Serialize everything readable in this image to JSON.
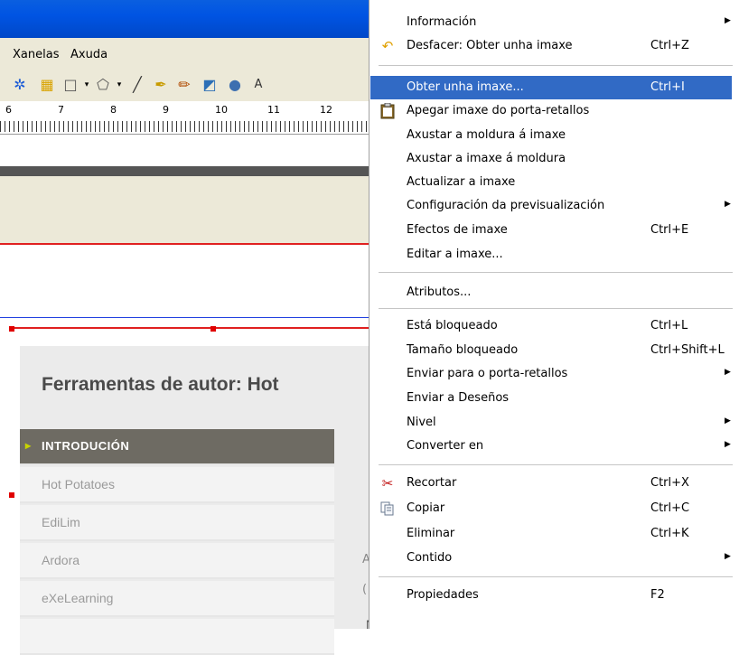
{
  "menubar": {
    "items": [
      "Xanelas",
      "Axuda"
    ]
  },
  "toolbar": {
    "icons": [
      "settings-icon",
      "table-icon",
      "rectangle-icon",
      "polygon-icon",
      "line-icon",
      "pen-icon",
      "pencil-icon",
      "image-icon",
      "zoom-icon",
      "text-icon"
    ]
  },
  "ruler": {
    "numbers": [
      "6",
      "7",
      "8",
      "9",
      "10",
      "11",
      "12"
    ]
  },
  "page": {
    "title": "Ferramentas de autor: Hot",
    "nav": [
      "Introdución",
      "Hot Potatoes",
      "EdiLim",
      "Ardora",
      "eXeLearning"
    ],
    "side_letters": [
      "A",
      "("
    ],
    "neste": "Neste"
  },
  "context_menu": {
    "items": [
      {
        "label": "Información",
        "shortcut": "",
        "submenu": true,
        "icon": ""
      },
      {
        "label": "Desfacer: Obter unha imaxe",
        "shortcut": "Ctrl+Z",
        "submenu": false,
        "icon": "undo-icon"
      },
      {
        "label": "Obter unha imaxe...",
        "shortcut": "Ctrl+I",
        "submenu": false,
        "icon": "",
        "selected": true
      },
      {
        "label": "Apegar imaxe do porta-retallos",
        "shortcut": "",
        "submenu": false,
        "icon": "clipboard-icon"
      },
      {
        "label": "Axustar a moldura á imaxe",
        "shortcut": "",
        "submenu": false,
        "icon": ""
      },
      {
        "label": "Axustar a imaxe á moldura",
        "shortcut": "",
        "submenu": false,
        "icon": ""
      },
      {
        "label": "Actualizar a imaxe",
        "shortcut": "",
        "submenu": false,
        "icon": ""
      },
      {
        "label": "Configuración da previsualización",
        "shortcut": "",
        "submenu": true,
        "icon": ""
      },
      {
        "label": "Efectos de imaxe",
        "shortcut": "Ctrl+E",
        "submenu": false,
        "icon": ""
      },
      {
        "label": "Editar a imaxe...",
        "shortcut": "",
        "submenu": false,
        "icon": ""
      },
      {
        "label": "Atributos...",
        "shortcut": "",
        "submenu": false,
        "icon": ""
      },
      {
        "label": "Está bloqueado",
        "shortcut": "Ctrl+L",
        "submenu": false,
        "icon": ""
      },
      {
        "label": "Tamaño bloqueado",
        "shortcut": "Ctrl+Shift+L",
        "submenu": false,
        "icon": ""
      },
      {
        "label": "Enviar para o porta-retallos",
        "shortcut": "",
        "submenu": true,
        "icon": ""
      },
      {
        "label": "Enviar a Deseños",
        "shortcut": "",
        "submenu": false,
        "icon": ""
      },
      {
        "label": "Nivel",
        "shortcut": "",
        "submenu": true,
        "icon": ""
      },
      {
        "label": "Converter en",
        "shortcut": "",
        "submenu": true,
        "icon": ""
      },
      {
        "label": "Recortar",
        "shortcut": "Ctrl+X",
        "submenu": false,
        "icon": "scissors-icon"
      },
      {
        "label": "Copiar",
        "shortcut": "Ctrl+C",
        "submenu": false,
        "icon": "copy-icon"
      },
      {
        "label": "Eliminar",
        "shortcut": "Ctrl+K",
        "submenu": false,
        "icon": ""
      },
      {
        "label": "Contido",
        "shortcut": "",
        "submenu": true,
        "icon": ""
      },
      {
        "label": "Propiedades",
        "shortcut": "F2",
        "submenu": false,
        "icon": ""
      }
    ]
  },
  "colors": {
    "selection": "#316ac5",
    "titlebar": "#0054e3",
    "nav_active": "#6e6b63"
  }
}
